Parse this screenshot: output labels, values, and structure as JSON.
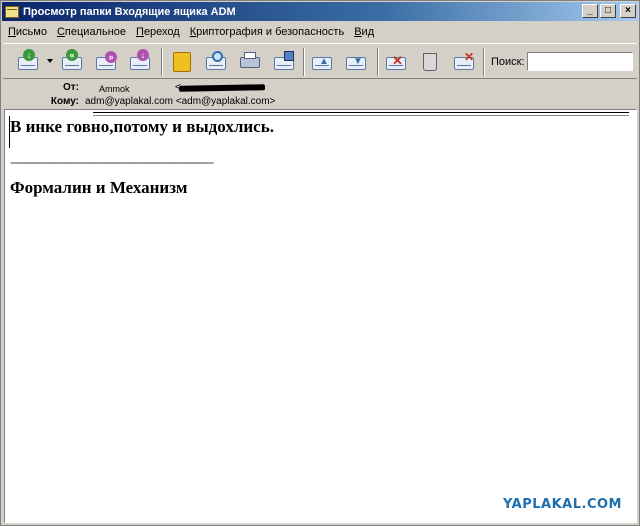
{
  "window": {
    "title": "Просмотр папки Входящие ящика ADM",
    "buttons": {
      "minimize": "_",
      "maximize": "□",
      "close": "×"
    }
  },
  "menu": [
    "Письмо",
    "Специальное",
    "Переход",
    "Криптография и безопасность",
    "Вид"
  ],
  "toolbar": {
    "search_label": "Поиск:",
    "search_value": "",
    "icons": [
      "get-mail-icon",
      "reply-icon",
      "forward-icon",
      "send-icon",
      "address-book-icon",
      "find-icon",
      "print-icon",
      "save-icon",
      "prev-icon",
      "next-icon",
      "mark-icon",
      "trash-icon",
      "delete-icon"
    ]
  },
  "header": {
    "from_label": "От:",
    "from_name": "Ammok",
    "from_email_prefix": "<",
    "to_label": "Кому:",
    "to_value": "adm@yaplakal.com <adm@yaplakal.com>"
  },
  "message": {
    "line1": "В инке говно,потому и выдохлись.",
    "separator": "-------------------------------------------------------------",
    "signature": "Формалин и Механизм"
  },
  "watermark": "YAPLAKAL.COM",
  "colors": {
    "accent_title_start": "#0a246a",
    "watermark": "#1e6fb0"
  }
}
